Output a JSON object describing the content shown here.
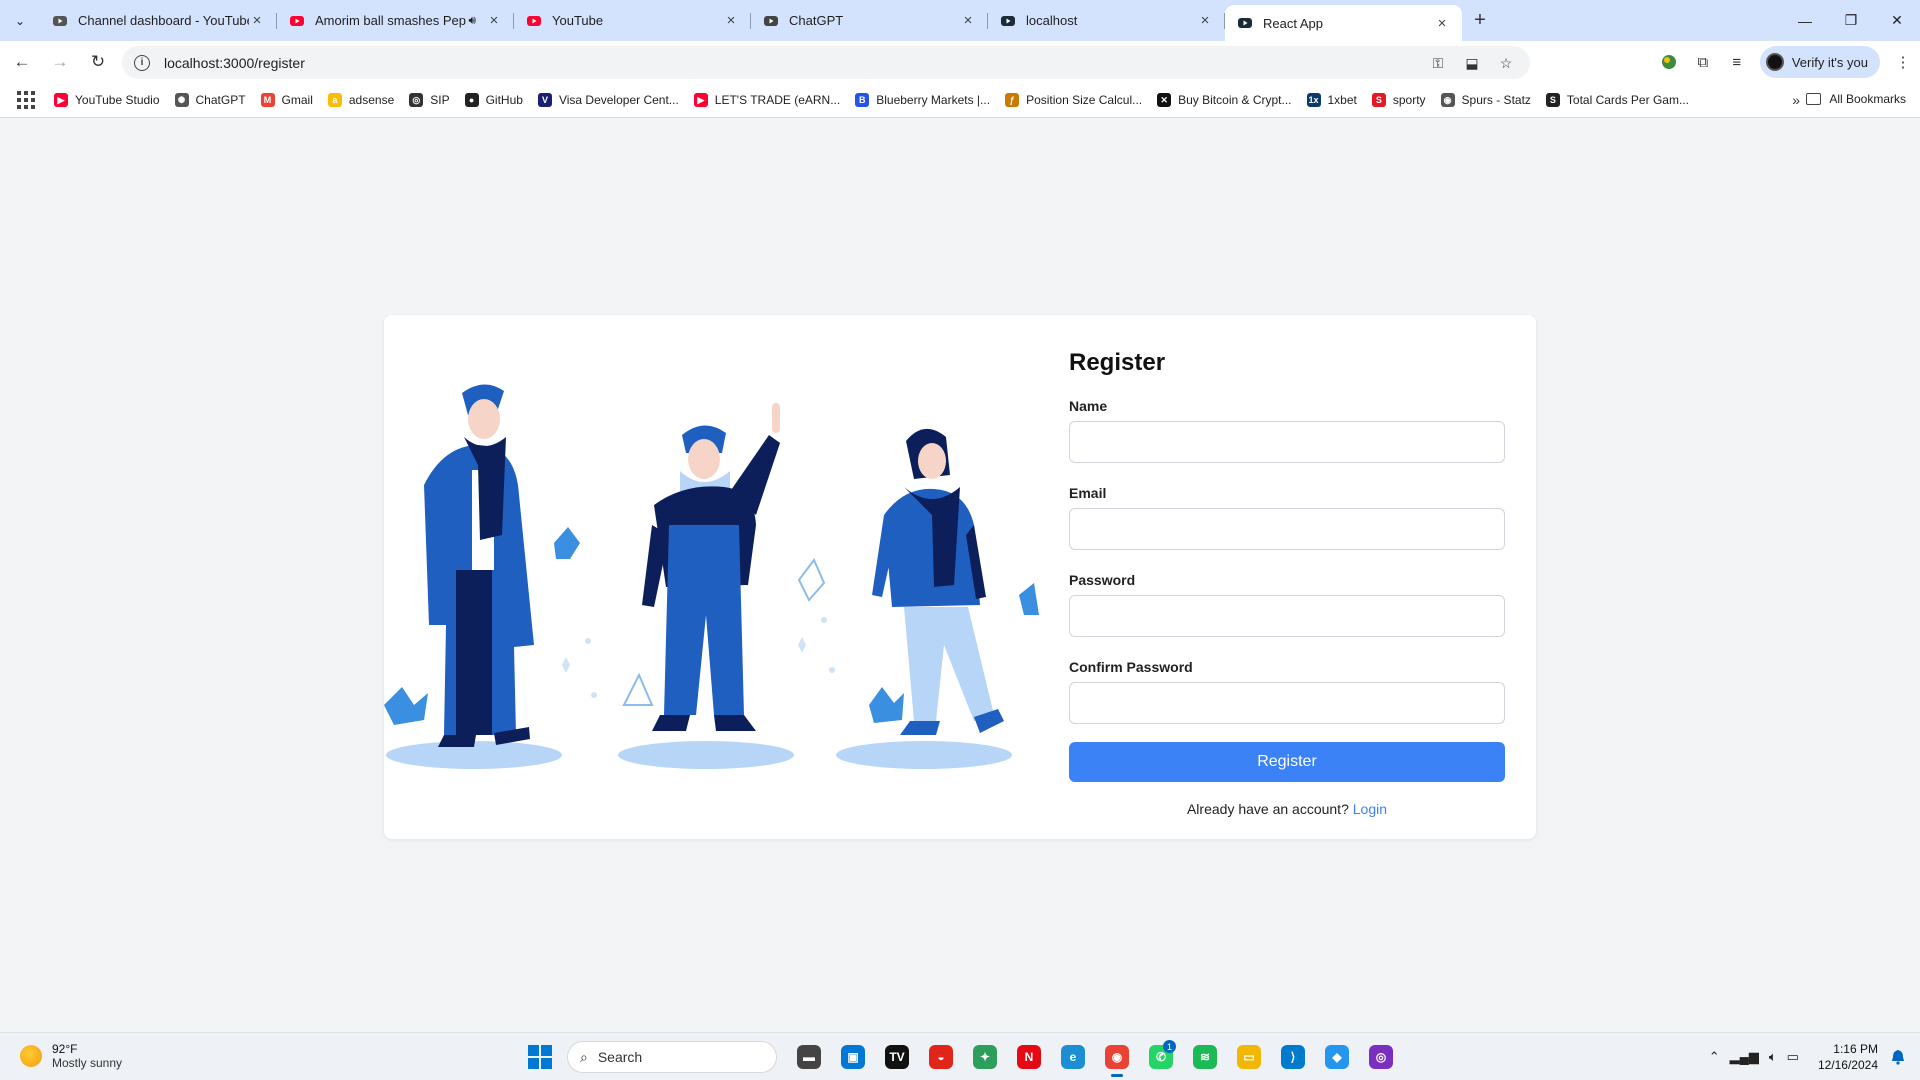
{
  "browser": {
    "tabs": [
      {
        "title": "Channel dashboard - YouTube Studio",
        "favicon": "youtube-studio-icon",
        "color": "#555555",
        "active": false,
        "audio": false
      },
      {
        "title": "Amorim ball smashes Pep at",
        "favicon": "youtube-icon",
        "color": "#ff0033",
        "active": false,
        "audio": true
      },
      {
        "title": "YouTube",
        "favicon": "youtube-icon",
        "color": "#ff0033",
        "active": false,
        "audio": false
      },
      {
        "title": "ChatGPT",
        "favicon": "chatgpt-icon",
        "color": "#444444",
        "active": false,
        "audio": false
      },
      {
        "title": "localhost",
        "favicon": "react-icon",
        "color": "#1c2b3a",
        "active": false,
        "audio": false
      },
      {
        "title": "React App",
        "favicon": "react-icon",
        "color": "#1c2b3a",
        "active": true,
        "audio": false
      }
    ],
    "url": "localhost:3000/register",
    "profile_label": "Verify it's you",
    "bookmarks": [
      {
        "label": "YouTube Studio",
        "color": "#ff0033",
        "glyph": "▶"
      },
      {
        "label": "ChatGPT",
        "color": "#555555",
        "glyph": "✺"
      },
      {
        "label": "Gmail",
        "color": "#ea4335",
        "glyph": "M"
      },
      {
        "label": "adsense",
        "color": "#fbbc04",
        "glyph": "a"
      },
      {
        "label": "SIP",
        "color": "#333333",
        "glyph": "◎"
      },
      {
        "label": "GitHub",
        "color": "#222222",
        "glyph": "●"
      },
      {
        "label": "Visa Developer Cent...",
        "color": "#1a1f71",
        "glyph": "V"
      },
      {
        "label": "LET'S TRADE (eARN...",
        "color": "#ff0033",
        "glyph": "▶"
      },
      {
        "label": "Blueberry Markets |...",
        "color": "#2454e6",
        "glyph": "B"
      },
      {
        "label": "Position Size Calcul...",
        "color": "#c97a00",
        "glyph": "ƒ"
      },
      {
        "label": "Buy Bitcoin & Crypt...",
        "color": "#111111",
        "glyph": "✕"
      },
      {
        "label": "1xbet",
        "color": "#0b3a6e",
        "glyph": "1x"
      },
      {
        "label": "sporty",
        "color": "#e41827",
        "glyph": "S"
      },
      {
        "label": "Spurs - Statz",
        "color": "#555555",
        "glyph": "◉"
      },
      {
        "label": "Total Cards Per Gam...",
        "color": "#222222",
        "glyph": "S"
      }
    ],
    "all_bookmarks_label": "All Bookmarks"
  },
  "page": {
    "title": "Register",
    "fields": [
      {
        "label": "Name",
        "type": "text",
        "value": "",
        "placeholder": ""
      },
      {
        "label": "Email",
        "type": "email",
        "value": "",
        "placeholder": ""
      },
      {
        "label": "Password",
        "type": "password",
        "value": "",
        "placeholder": ""
      },
      {
        "label": "Confirm Password",
        "type": "password",
        "value": "",
        "placeholder": ""
      }
    ],
    "submit_label": "Register",
    "login_prompt": "Already have an account?",
    "login_link": "Login",
    "accent_color": "#3b82f6"
  },
  "taskbar": {
    "weather_temp": "92°F",
    "weather_desc": "Mostly sunny",
    "search_label": "Search",
    "apps": [
      {
        "name": "file-explorer-app",
        "color": "#444444",
        "glyph": "▬"
      },
      {
        "name": "microsoft-store-app",
        "color": "#0078d4",
        "glyph": "▣"
      },
      {
        "name": "tradingview-app",
        "color": "#111111",
        "glyph": "TV"
      },
      {
        "name": "acrobat-app",
        "color": "#e0251b",
        "glyph": "◒"
      },
      {
        "name": "green-app",
        "color": "#2e9e5b",
        "glyph": "✦"
      },
      {
        "name": "netflix-app",
        "color": "#e50914",
        "glyph": "N"
      },
      {
        "name": "edge-app",
        "color": "#1b8fd1",
        "glyph": "e"
      },
      {
        "name": "chrome-app",
        "color": "#ea4335",
        "glyph": "◉"
      },
      {
        "name": "whatsapp-app",
        "color": "#25d366",
        "glyph": "✆",
        "badge": "1"
      },
      {
        "name": "spotify-app",
        "color": "#1db954",
        "glyph": "≋"
      },
      {
        "name": "folder-app",
        "color": "#f2b705",
        "glyph": "▭"
      },
      {
        "name": "vscode-app",
        "color": "#007acc",
        "glyph": "⟩"
      },
      {
        "name": "docker-app",
        "color": "#2496ed",
        "glyph": "◆"
      },
      {
        "name": "purple-app",
        "color": "#7b2fbf",
        "glyph": "◎"
      }
    ],
    "time": "1:16 PM",
    "date": "12/16/2024"
  }
}
